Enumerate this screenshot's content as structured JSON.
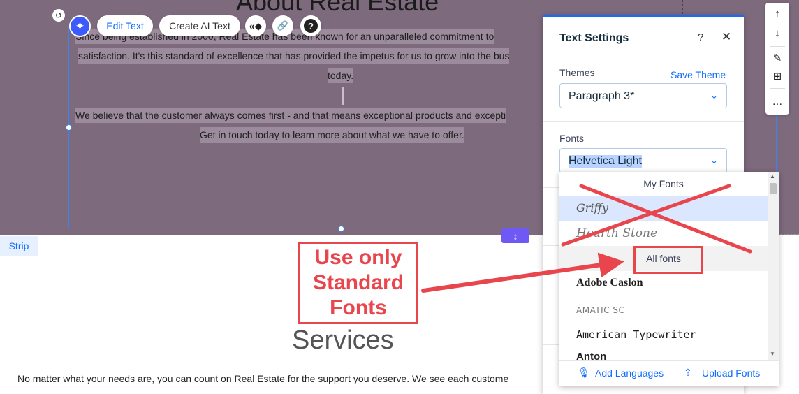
{
  "canvas": {
    "section_title": "About Real Estate",
    "paragraph_lines": [
      "Since being established in 2000, Real Estate has been known for an unparalleled commitment to",
      "satisfaction. It's this standard of excellence that has provided the impetus for us to grow into the bus",
      "today.",
      "We believe that the customer always comes first - and that means exceptional products and excepti",
      "Get in touch today to learn more about what we have to offer."
    ],
    "strip_label": "Strip",
    "stretch_icon": "↕",
    "services_title": "Services",
    "services_text": "No matter what your needs are, you can count on Real Estate for the support you deserve. We see each custome"
  },
  "toolbar": {
    "ai_icon": "✦",
    "undo_icon": "↺",
    "edit_text_label": "Edit Text",
    "create_ai_text_label": "Create AI Text",
    "animation_icon": "«◆",
    "link_icon": "🔗",
    "help_icon": "?"
  },
  "mini_toolbar": {
    "up_icon": "↑",
    "down_icon": "↓",
    "pen_icon": "✎",
    "layout_icon": "⊞",
    "more_icon": "…"
  },
  "panel": {
    "title": "Text Settings",
    "help_icon": "?",
    "close_icon": "✕",
    "themes_label": "Themes",
    "save_theme_label": "Save Theme",
    "theme_value": "Paragraph 3*",
    "fonts_label": "Fonts",
    "font_value": "Helvetica Light",
    "chevron_icon": "⌄"
  },
  "font_dropdown": {
    "my_fonts_header": "My Fonts",
    "my_fonts": [
      "Griffy",
      "Hearth Stone"
    ],
    "all_fonts_header": "All fonts",
    "all_fonts": [
      "Adobe Caslon",
      "AMATIC SC",
      "American Typewriter",
      "Anton"
    ],
    "add_languages_label": "Add Languages",
    "upload_fonts_label": "Upload Fonts",
    "add_languages_icon": "🎙",
    "upload_icon": "⇪"
  },
  "annotation": {
    "callout_lines": [
      "Use only",
      "Standard",
      "Fonts"
    ],
    "color": "#e8454c"
  }
}
